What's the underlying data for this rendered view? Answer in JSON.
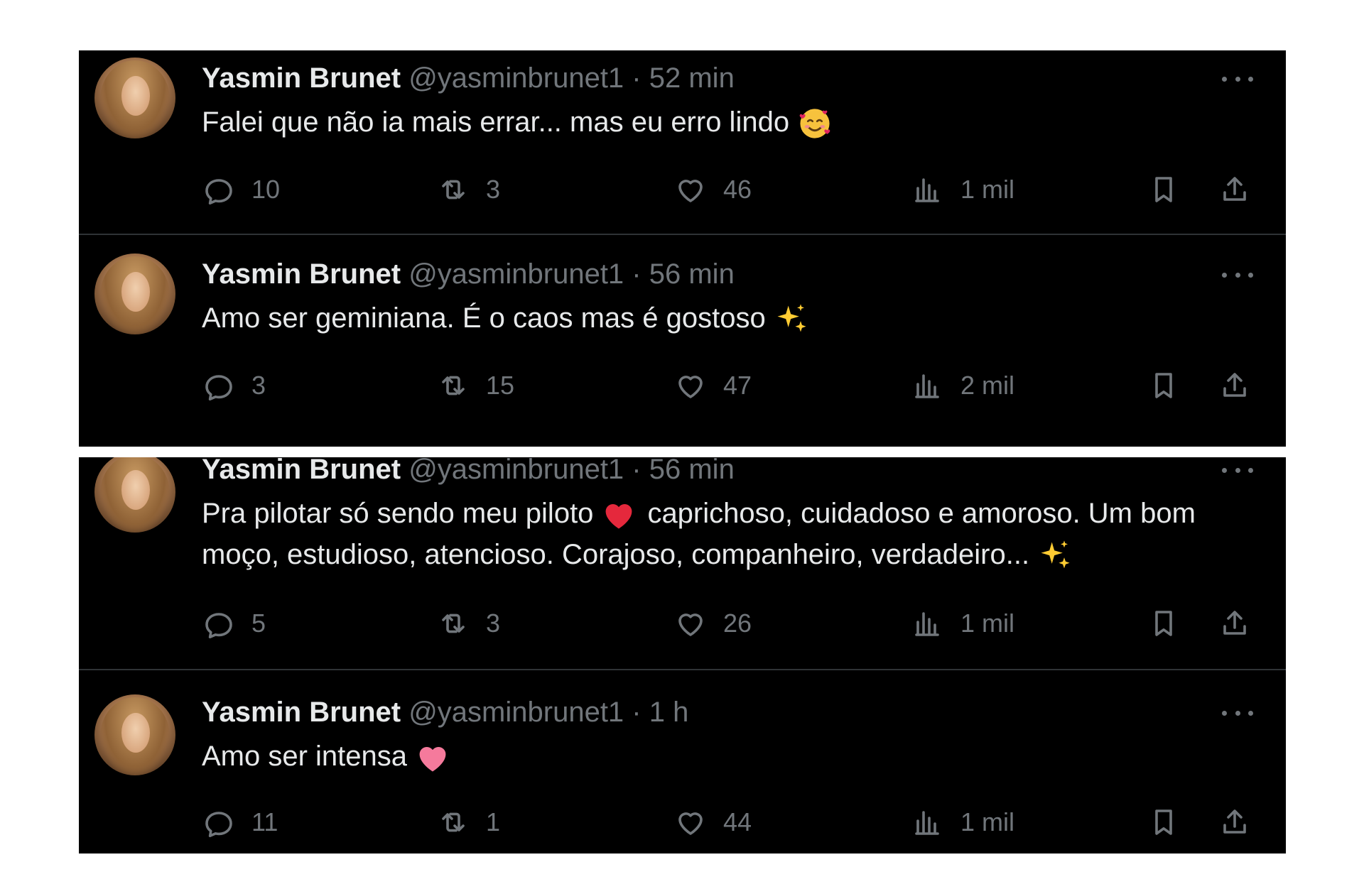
{
  "tweets": [
    {
      "name": "Yasmin Brunet",
      "handle": "@yasminbrunet1",
      "separator": "·",
      "time": "52 min",
      "text": "Falei que não ia mais errar... mas eu erro lindo",
      "emoji": "smiling-face-with-hearts",
      "replies": "10",
      "retweets": "3",
      "likes": "46",
      "views": "1 mil"
    },
    {
      "name": "Yasmin Brunet",
      "handle": "@yasminbrunet1",
      "separator": "·",
      "time": "56 min",
      "text": "Amo ser geminiana. É o caos mas é gostoso",
      "emoji": "sparkles",
      "replies": "3",
      "retweets": "15",
      "likes": "47",
      "views": "2 mil"
    },
    {
      "name": "Yasmin Brunet",
      "handle": "@yasminbrunet1",
      "separator": "·",
      "time": "56 min",
      "text_part1": "Pra pilotar só sendo meu piloto",
      "text_part2": "caprichoso, cuidadoso e amoroso. Um bom moço, estudioso, atencioso. Corajoso, companheiro, verdadeiro...",
      "emoji1": "red-heart",
      "emoji2": "sparkles",
      "replies": "5",
      "retweets": "3",
      "likes": "26",
      "views": "1 mil"
    },
    {
      "name": "Yasmin Brunet",
      "handle": "@yasminbrunet1",
      "separator": "·",
      "time": "1 h",
      "text": "Amo ser intensa",
      "emoji": "pink-heart",
      "replies": "11",
      "retweets": "1",
      "likes": "44",
      "views": "1 mil"
    }
  ],
  "colors": {
    "background": "#000000",
    "text": "#e7e9ea",
    "muted": "#71767b",
    "divider": "#2f3336",
    "page": "#ffffff"
  }
}
